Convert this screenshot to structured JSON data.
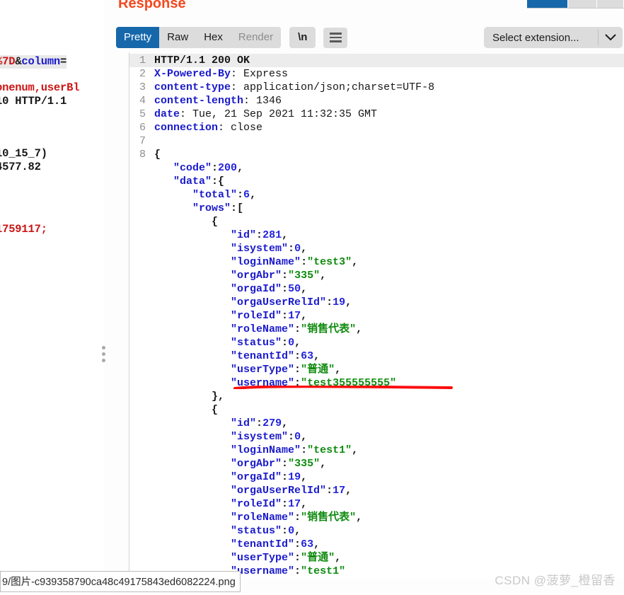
{
  "panel": {
    "title": "Response"
  },
  "toolbar": {
    "tabs": [
      {
        "label": "Pretty",
        "state": "active"
      },
      {
        "label": "Raw",
        "state": "normal"
      },
      {
        "label": "Hex",
        "state": "normal"
      },
      {
        "label": "Render",
        "state": "disabled"
      }
    ],
    "newline_button": "\\n",
    "menu_icon": "hamburger-menu-icon"
  },
  "extension_select": {
    "value": "Select extension...",
    "chevron_icon": "chevron-down-icon"
  },
  "left_request_panel": {
    "fragments": [
      {
        "text": "%7D&column=",
        "style": "highlight"
      },
      {
        "text": "onenum,userBl",
        "style": "plain"
      },
      {
        "text": "10 HTTP/1.1",
        "style": "plain"
      },
      {
        "text": "10_15_7)",
        "style": "plain"
      },
      {
        "text": "4577.82",
        "style": "plain"
      },
      {
        "text": "1759117;",
        "style": "red"
      }
    ]
  },
  "splitter": {
    "icon": "drag-handle-dots-icon"
  },
  "response": {
    "line_numbers": [
      "1",
      "2",
      "3",
      "4",
      "5",
      "6",
      "7",
      "8"
    ],
    "status_line": "HTTP/1.1 200 OK",
    "headers": [
      {
        "name": "X-Powered-By",
        "value": " Express"
      },
      {
        "name": "content-type",
        "value": " application/json;charset=UTF-8"
      },
      {
        "name": "content-length",
        "value": " 1346"
      },
      {
        "name": "date",
        "value": " Tue, 21 Sep 2021 11:32:35 GMT"
      },
      {
        "name": "connection",
        "value": " close"
      }
    ],
    "body": {
      "code": 200,
      "data": {
        "total": 6,
        "rows": [
          {
            "id": 281,
            "isystem": 0,
            "loginName": "test3",
            "orgAbr": "335",
            "orgaId": 50,
            "orgaUserRelId": 19,
            "roleId": 17,
            "roleName": "销售代表",
            "status": 0,
            "tenantId": 63,
            "userType": "普通",
            "username": "test355555555"
          },
          {
            "id": 279,
            "isystem": 0,
            "loginName": "test1",
            "orgAbr": "335",
            "orgaId": 19,
            "orgaUserRelId": 17,
            "roleId": 17,
            "roleName": "销售代表",
            "status": 0,
            "tenantId": 63,
            "userType": "普通",
            "username": "test1"
          }
        ]
      }
    }
  },
  "annotation": {
    "type": "red-underline",
    "color": "#fb0d0d",
    "targets": "username value test355555555"
  },
  "status_bar": {
    "filename": "9/图片-c939358790ca48c49175843ed6082224.png"
  },
  "watermark": {
    "text": "CSDN @菠萝_橙留香"
  }
}
